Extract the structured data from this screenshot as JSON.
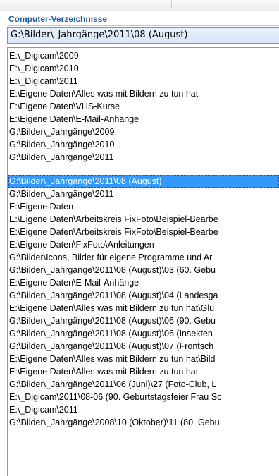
{
  "panel": {
    "title": "Computer-Verzeichnisse",
    "current_path": "G:\\Bilder\\_Jahrgänge\\2011\\08 (August)"
  },
  "group1": [
    "E:\\_Digicam\\2009",
    "E:\\_Digicam\\2010",
    "E:\\_Digicam\\2011",
    "E:\\Eigene Daten\\Alles was mit Bildern zu tun hat",
    "E:\\Eigene Daten\\VHS-Kurse",
    "E:\\Eigene Daten\\E-Mail-Anhänge",
    "G:\\Bilder\\_Jahrgänge\\2009",
    "G:\\Bilder\\_Jahrgänge\\2010",
    "G:\\Bilder\\_Jahrgänge\\2011"
  ],
  "group2": [
    "G:\\Bilder\\_Jahrgänge\\2011\\08 (August)",
    "G:\\Bilder\\_Jahrgänge\\2011",
    "E:\\Eigene Daten",
    "E:\\Eigene Daten\\Arbeitskreis FixFoto\\Beispiel-Bearbe",
    "E:\\Eigene Daten\\Arbeitskreis FixFoto\\Beispiel-Bearbe",
    "E:\\Eigene Daten\\FixFoto\\Anleitungen",
    "G:\\Bilder\\Icons, Bilder für eigene Programme und Ar",
    "G:\\Bilder\\_Jahrgänge\\2011\\08 (August)\\03 (60. Gebu",
    "E:\\Eigene Daten\\E-Mail-Anhänge",
    "G:\\Bilder\\_Jahrgänge\\2011\\08 (August)\\04 (Landesga",
    "E:\\Eigene Daten\\Alles was mit Bildern zu tun hat\\Glü",
    "G:\\Bilder\\_Jahrgänge\\2011\\08 (August)\\06 (90. Gebu",
    "G:\\Bilder\\_Jahrgänge\\2011\\08 (August)\\06 (Insekten",
    "G:\\Bilder\\_Jahrgänge\\2011\\08 (August)\\07 (Frontsch",
    "E:\\Eigene Daten\\Alles was mit Bildern zu tun hat\\Bild",
    "E:\\Eigene Daten\\Alles was mit Bildern zu tun hat",
    "G:\\Bilder\\_Jahrgänge\\2011\\06 (Juni)\\27 (Foto-Club, L",
    "E:\\_Digicam\\2011\\08-06 (90. Geburtstagsfeier Frau Sc",
    "E:\\_Digicam\\2011",
    "G:\\Bilder\\_Jahrgänge\\2008\\10 (Oktober)\\11 (80. Gebu"
  ],
  "selected_index_group2": 0,
  "colors": {
    "title": "#1f5aa8",
    "selection": "#3399ff",
    "combo_border": "#7a96c0"
  }
}
